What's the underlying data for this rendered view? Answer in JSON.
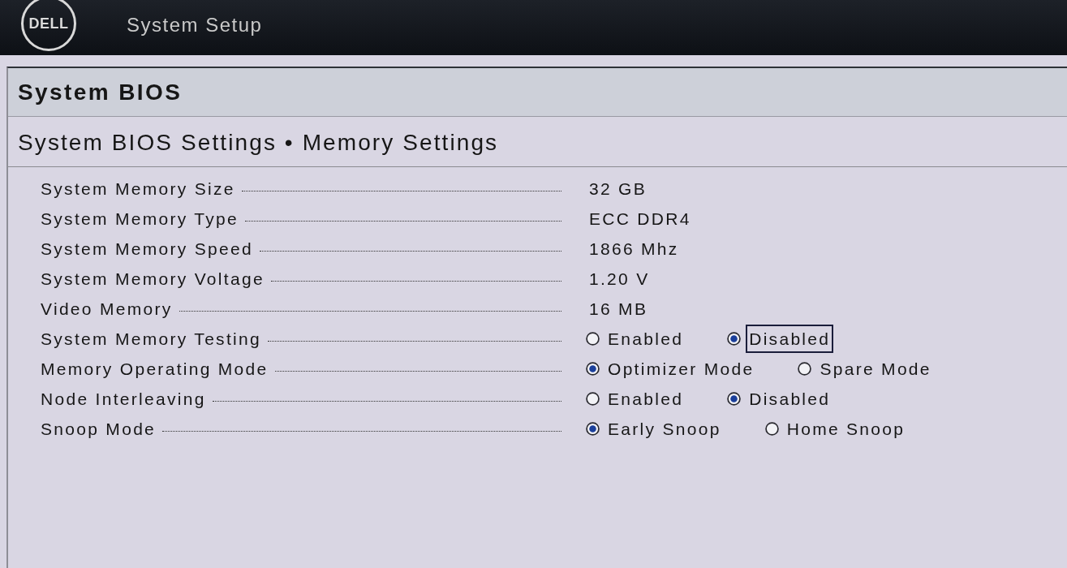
{
  "header": {
    "logo_text": "DELL",
    "title": "System Setup"
  },
  "page_title": "System BIOS",
  "section_title": "System BIOS Settings • Memory Settings",
  "rows": [
    {
      "kind": "text",
      "label": "System Memory Size",
      "value": "32 GB",
      "focused": false
    },
    {
      "kind": "text",
      "label": "System Memory Type",
      "value": "ECC DDR4",
      "focused": false
    },
    {
      "kind": "text",
      "label": "System Memory Speed",
      "value": "1866 Mhz",
      "focused": false
    },
    {
      "kind": "text",
      "label": "System Memory Voltage",
      "value": "1.20 V",
      "focused": false
    },
    {
      "kind": "text",
      "label": "Video Memory",
      "value": "16 MB",
      "focused": false
    },
    {
      "kind": "radio",
      "label": "System Memory Testing",
      "focused": true,
      "options": [
        {
          "label": "Enabled",
          "selected": false
        },
        {
          "label": "Disabled",
          "selected": true
        }
      ]
    },
    {
      "kind": "radio",
      "label": "Memory Operating Mode",
      "focused": false,
      "options": [
        {
          "label": "Optimizer Mode",
          "selected": true
        },
        {
          "label": "Spare Mode",
          "selected": false
        }
      ]
    },
    {
      "kind": "radio",
      "label": "Node Interleaving",
      "focused": false,
      "options": [
        {
          "label": "Enabled",
          "selected": false
        },
        {
          "label": "Disabled",
          "selected": true
        }
      ]
    },
    {
      "kind": "radio",
      "label": "Snoop Mode",
      "focused": false,
      "options": [
        {
          "label": "Early Snoop",
          "selected": true
        },
        {
          "label": "Home Snoop",
          "selected": false
        }
      ]
    }
  ]
}
